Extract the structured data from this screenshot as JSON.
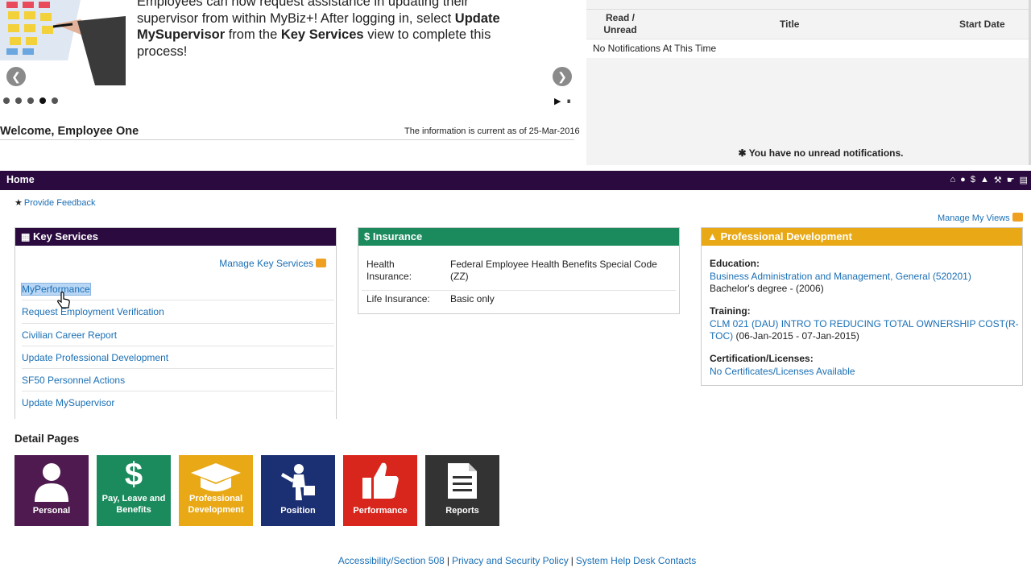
{
  "carousel": {
    "text_prefix": "Employees can now request assistance in updating their supervisor from within MyBiz+! After logging in, select",
    "bold1": "Update MySupervisor",
    "text_mid": "from the",
    "bold2": "Key Services",
    "text_suffix": "view to complete this process!",
    "prev_icon": "chevron-left-icon",
    "next_icon": "chevron-right-icon",
    "dot_count": 5,
    "active_dot": 4,
    "controls": "▶ ⏸"
  },
  "welcome": {
    "greeting": "Welcome, Employee One",
    "current_as_of": "The information is current as of 25-Mar-2016"
  },
  "notifications": {
    "col_read": "Read / Unread",
    "col_title": "Title",
    "col_start": "Start Date",
    "empty_row": "No Notifications At This Time",
    "footer": "✱  You have no unread notifications."
  },
  "navbar": {
    "home": "Home",
    "icons": [
      "home-icon",
      "person-icon",
      "dollar-icon",
      "graduation-cap-icon",
      "position-icon",
      "thumbs-up-icon",
      "reports-icon"
    ]
  },
  "feedback": {
    "label": "Provide Feedback"
  },
  "manage_views": {
    "label": "Manage My Views"
  },
  "key_services": {
    "title": "Key Services",
    "manage": "Manage Key Services",
    "items": [
      "MyPerformance",
      "Request Employment Verification",
      "Civilian Career Report",
      "Update Professional Development",
      "SF50 Personnel Actions",
      "Update MySupervisor"
    ]
  },
  "insurance": {
    "title": "$ Insurance",
    "rows": [
      {
        "label": "Health Insurance:",
        "value": "Federal Employee Health Benefits Special Code (ZZ)"
      },
      {
        "label": "Life Insurance:",
        "value": "Basic only"
      }
    ]
  },
  "professional_development": {
    "title": "Professional Development",
    "education_label": "Education:",
    "education_link": "Business Administration and Management, General (520201)",
    "education_detail": "Bachelor's degree - (2006)",
    "training_label": "Training:",
    "training_link": "CLM 021 (DAU) INTRO TO REDUCING TOTAL OWNERSHIP COST(R-TOC)",
    "training_dates": "(06-Jan-2015 - 07-Jan-2015)",
    "cert_label": "Certification/Licenses:",
    "cert_link": "No Certificates/Licenses Available"
  },
  "detail_pages": {
    "title": "Detail Pages",
    "tiles": [
      {
        "label": "Personal",
        "color": "#4f1a4f",
        "icon": "person-icon"
      },
      {
        "label": "Pay, Leave and Benefits",
        "color": "#1b8b5e",
        "icon": "dollar-icon"
      },
      {
        "label": "Professional Development",
        "color": "#e9a916",
        "icon": "graduation-cap-icon"
      },
      {
        "label": "Position",
        "color": "#1b2f73",
        "icon": "position-icon"
      },
      {
        "label": "Performance",
        "color": "#d9261c",
        "icon": "thumbs-up-icon"
      },
      {
        "label": "Reports",
        "color": "#333333",
        "icon": "document-icon"
      }
    ]
  },
  "footer": {
    "links": [
      "Accessibility/Section 508",
      "Privacy and Security Policy",
      "System Help Desk Contacts"
    ],
    "separator": "|"
  }
}
